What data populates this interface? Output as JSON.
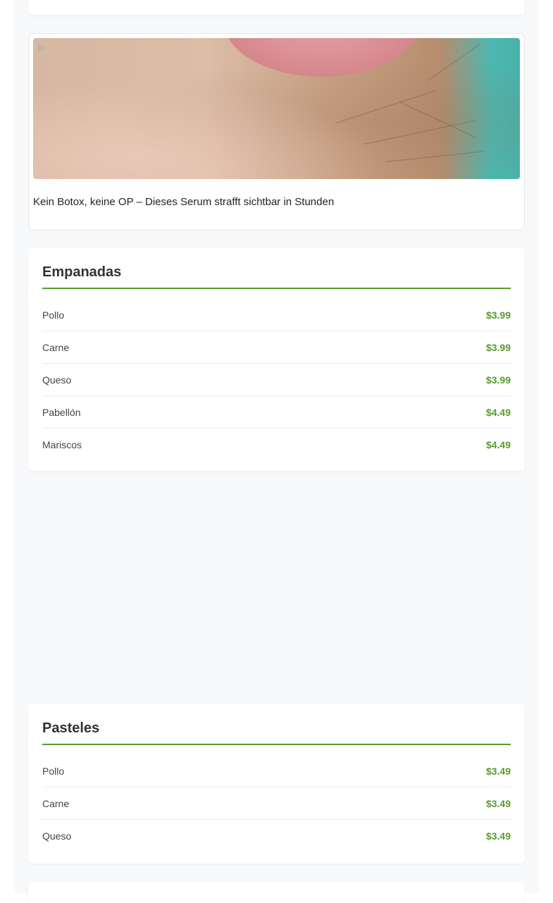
{
  "ad": {
    "headline": "Kein Botox, keine OP – Dieses Serum strafft sichtbar in Stunden",
    "icon": "ad-choices-icon"
  },
  "sections": [
    {
      "title": "Empanadas",
      "items": [
        {
          "name": "Pollo",
          "price": "$3.99"
        },
        {
          "name": "Carne",
          "price": "$3.99"
        },
        {
          "name": "Queso",
          "price": "$3.99"
        },
        {
          "name": "Pabellón",
          "price": "$4.49"
        },
        {
          "name": "Mariscos",
          "price": "$4.49"
        }
      ]
    },
    {
      "title": "Pasteles",
      "items": [
        {
          "name": "Pollo",
          "price": "$3.49"
        },
        {
          "name": "Carne",
          "price": "$3.49"
        },
        {
          "name": "Queso",
          "price": "$3.49"
        }
      ]
    }
  ],
  "colors": {
    "accent": "#5a9a2a",
    "background": "#f8f9fa"
  }
}
